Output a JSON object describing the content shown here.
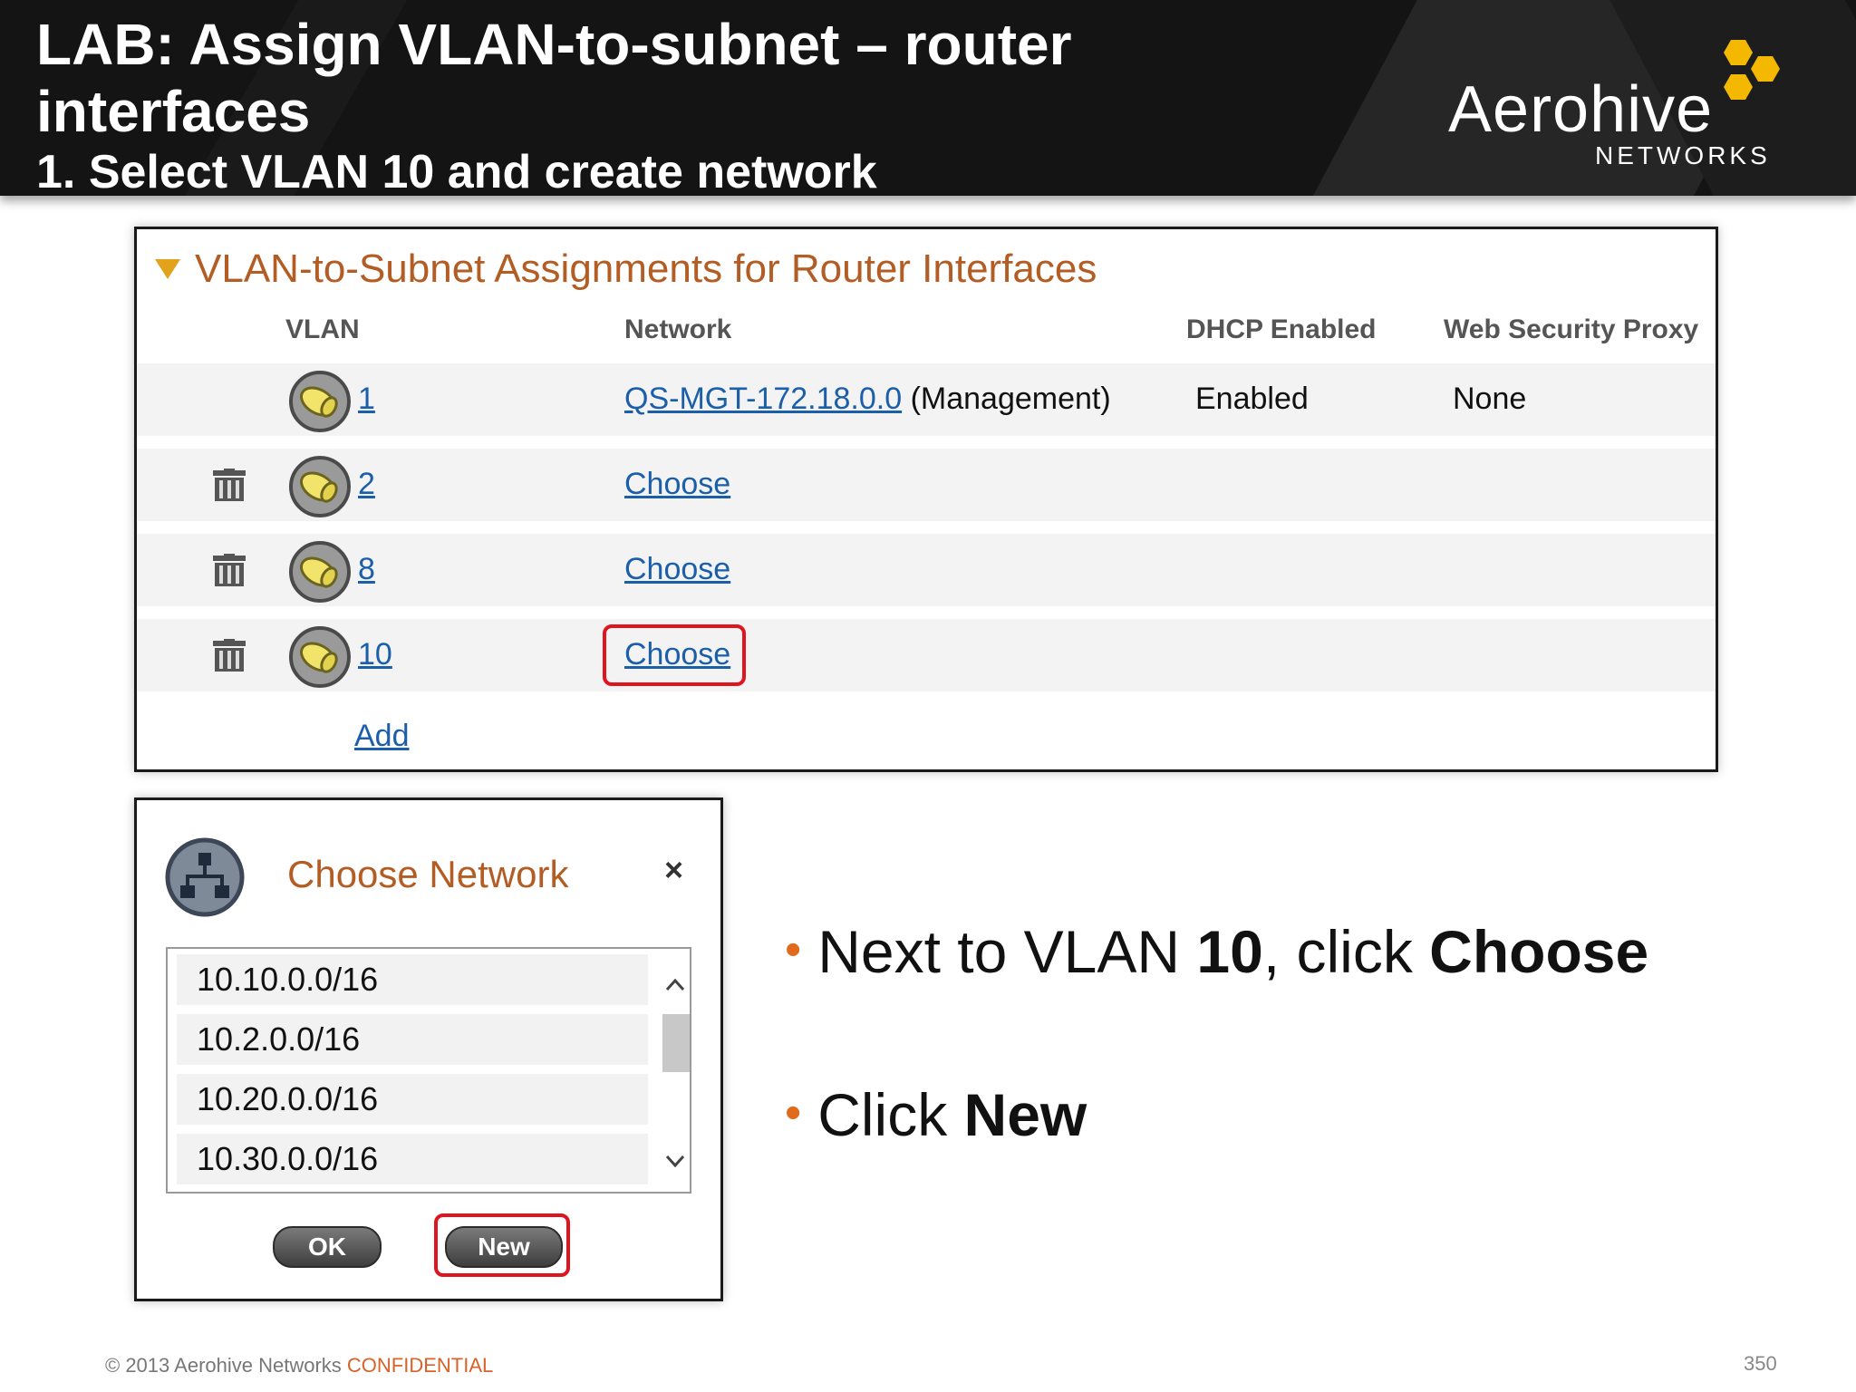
{
  "header": {
    "title_line1": "LAB: Assign VLAN-to-subnet – router",
    "title_line2": "interfaces",
    "subtitle": "1. Select VLAN 10 and create network",
    "logo_text": "Aerohive",
    "logo_sub": "NETWORKS"
  },
  "section": {
    "title": "VLAN-to-Subnet Assignments for Router Interfaces",
    "columns": [
      "VLAN",
      "Network",
      "DHCP Enabled",
      "Web Security Proxy"
    ],
    "rows": [
      {
        "vlan": "1",
        "network_link": "QS-MGT-172.18.0.0",
        "network_suffix": " (Management)",
        "dhcp": "Enabled",
        "proxy": "None"
      },
      {
        "vlan": "2",
        "network_link": "Choose"
      },
      {
        "vlan": "8",
        "network_link": "Choose"
      },
      {
        "vlan": "10",
        "network_link": "Choose"
      }
    ],
    "add_label": "Add"
  },
  "dialog": {
    "title": "Choose Network",
    "close": "×",
    "networks": [
      "10.10.0.0/16",
      "10.2.0.0/16",
      "10.20.0.0/16",
      "10.30.0.0/16"
    ],
    "ok_label": "OK",
    "new_label": "New"
  },
  "bullets": {
    "b1_pre": "Next to VLAN ",
    "b1_bold1": "10",
    "b1_mid": ", click ",
    "b1_bold2": "Choose",
    "b2_pre": "Click ",
    "b2_bold": "New"
  },
  "footer": {
    "copyright": "© 2013 Aerohive Networks ",
    "confidential": "CONFIDENTIAL",
    "page": "350"
  },
  "colors": {
    "header_bg": "#141414",
    "accent_orange": "#b35d24",
    "link_blue": "#1b5eaa",
    "highlight_red": "#e0141e",
    "logo_yellow": "#f5b800"
  }
}
